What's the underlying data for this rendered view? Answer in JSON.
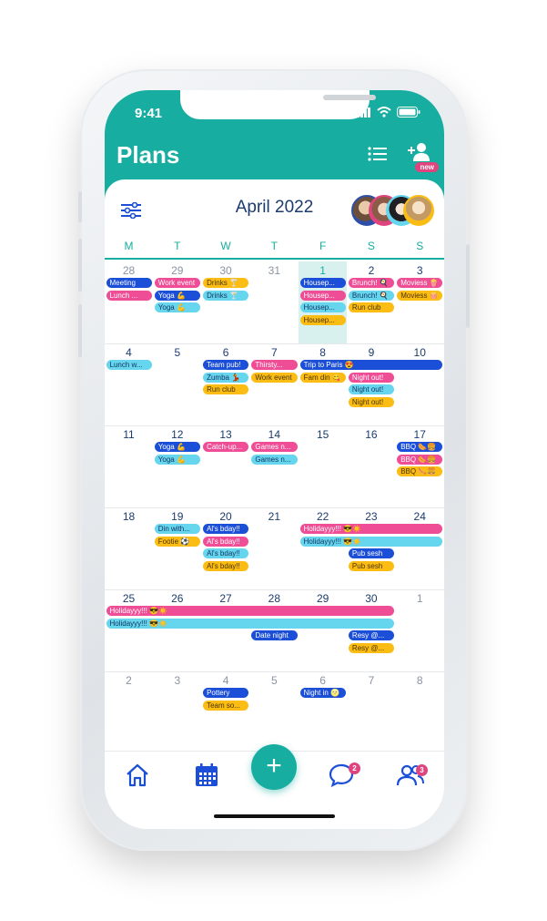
{
  "status_bar": {
    "time": "9:41"
  },
  "header": {
    "title": "Plans",
    "new_badge": "new",
    "list_icon": "list-icon",
    "add_person_icon": "add-person-icon"
  },
  "calendar": {
    "month": "April 2022",
    "weekdays": [
      "M",
      "T",
      "W",
      "T",
      "F",
      "S",
      "S"
    ],
    "weeks": [
      [
        {
          "day": "28",
          "muted": true,
          "events": [
            {
              "text": "Meeting",
              "color": "blue"
            },
            {
              "text": "Lunch ...",
              "color": "pink"
            }
          ]
        },
        {
          "day": "29",
          "muted": true,
          "events": [
            {
              "text": "Work event",
              "color": "pink"
            },
            {
              "text": "Yoga 💪",
              "color": "blue"
            },
            {
              "text": "Yoga 💪",
              "color": "cyan"
            }
          ]
        },
        {
          "day": "30",
          "muted": true,
          "events": [
            {
              "text": "Drinks 🍸",
              "color": "yellow"
            },
            {
              "text": "Drinks 🍸",
              "color": "cyan"
            }
          ]
        },
        {
          "day": "31",
          "muted": true,
          "events": []
        },
        {
          "day": "1",
          "today": true,
          "events": [
            {
              "text": "Housep...",
              "color": "blue"
            },
            {
              "text": "Housep...",
              "color": "pink"
            },
            {
              "text": "Housep...",
              "color": "cyan"
            },
            {
              "text": "Housep...",
              "color": "yellow"
            }
          ]
        },
        {
          "day": "2",
          "events": [
            {
              "text": "Brunch! 🍳",
              "color": "pink"
            },
            {
              "text": "Brunch! 🍳",
              "color": "cyan"
            },
            {
              "text": "Run club",
              "color": "yellow"
            }
          ]
        },
        {
          "day": "3",
          "events": [
            {
              "text": "Moviess 🍿",
              "color": "pink"
            },
            {
              "text": "Moviess 🍿",
              "color": "yellow"
            }
          ]
        }
      ],
      [
        {
          "day": "4",
          "events": [
            {
              "text": "Lunch w...",
              "color": "cyan"
            }
          ]
        },
        {
          "day": "5",
          "events": []
        },
        {
          "day": "6",
          "events": [
            {
              "text": "Team pub!",
              "color": "blue"
            },
            {
              "text": "Zumba 💃",
              "color": "cyan"
            },
            {
              "text": "Run club",
              "color": "yellow"
            }
          ]
        },
        {
          "day": "7",
          "events": [
            {
              "text": "Thirsty...",
              "color": "pink"
            },
            {
              "text": "Work event",
              "color": "yellow"
            }
          ]
        },
        {
          "day": "8",
          "events": [
            {
              "text": "Fam din 😋",
              "color": "yellow"
            }
          ]
        },
        {
          "day": "9",
          "events": [
            {
              "text": "Night out!",
              "color": "pink"
            },
            {
              "text": "Night out!",
              "color": "cyan"
            },
            {
              "text": "Night out!",
              "color": "yellow"
            }
          ]
        },
        {
          "day": "10",
          "events": []
        }
      ],
      [
        {
          "day": "11",
          "events": []
        },
        {
          "day": "12",
          "events": [
            {
              "text": "Yoga 💪",
              "color": "blue"
            },
            {
              "text": "Yoga 💪",
              "color": "cyan"
            }
          ]
        },
        {
          "day": "13",
          "events": [
            {
              "text": "Catch-up...",
              "color": "pink"
            }
          ]
        },
        {
          "day": "14",
          "events": [
            {
              "text": "Games n...",
              "color": "pink"
            },
            {
              "text": "Games n...",
              "color": "cyan"
            }
          ]
        },
        {
          "day": "15",
          "events": []
        },
        {
          "day": "16",
          "events": []
        },
        {
          "day": "17",
          "events": [
            {
              "text": "BBQ 🌭🍔",
              "color": "blue"
            },
            {
              "text": "BBQ 🌭🍔",
              "color": "pink"
            },
            {
              "text": "BBQ 🌭🍔",
              "color": "yellow"
            }
          ]
        }
      ],
      [
        {
          "day": "18",
          "events": []
        },
        {
          "day": "19",
          "events": [
            {
              "text": "Din with...",
              "color": "cyan"
            },
            {
              "text": "Footie ⚽",
              "color": "yellow"
            }
          ]
        },
        {
          "day": "20",
          "events": [
            {
              "text": "Al's bday!!",
              "color": "blue"
            },
            {
              "text": "Al's bday!!",
              "color": "pink"
            },
            {
              "text": "Al's bday!!",
              "color": "cyan"
            },
            {
              "text": "Al's bday!!",
              "color": "yellow"
            }
          ]
        },
        {
          "day": "21",
          "events": []
        },
        {
          "day": "22",
          "events": []
        },
        {
          "day": "23",
          "events": [
            {
              "text": "Pub sesh",
              "color": "blue"
            },
            {
              "text": "Pub sesh",
              "color": "yellow"
            }
          ]
        },
        {
          "day": "24",
          "events": []
        }
      ],
      [
        {
          "day": "25",
          "events": []
        },
        {
          "day": "26",
          "events": []
        },
        {
          "day": "27",
          "events": []
        },
        {
          "day": "28",
          "events": [
            {
              "text": "Date night",
              "color": "blue"
            }
          ]
        },
        {
          "day": "29",
          "events": []
        },
        {
          "day": "30",
          "events": [
            {
              "text": "Resy @...",
              "color": "blue"
            },
            {
              "text": "Resy @...",
              "color": "yellow"
            }
          ]
        },
        {
          "day": "1",
          "muted": true,
          "events": []
        }
      ],
      [
        {
          "day": "2",
          "muted": true,
          "events": []
        },
        {
          "day": "3",
          "muted": true,
          "events": []
        },
        {
          "day": "4",
          "muted": true,
          "events": [
            {
              "text": "Pottery",
              "color": "blue"
            },
            {
              "text": "Team so...",
              "color": "yellow"
            }
          ]
        },
        {
          "day": "5",
          "muted": true,
          "events": []
        },
        {
          "day": "6",
          "muted": true,
          "events": [
            {
              "text": "Night in 🌝",
              "color": "blue"
            }
          ]
        },
        {
          "day": "7",
          "muted": true,
          "events": []
        },
        {
          "day": "8",
          "muted": true,
          "events": []
        }
      ]
    ],
    "span_events": [
      {
        "text": "Trip to Paris 😍",
        "color": "blue",
        "week": 1,
        "start": 4,
        "end": 6,
        "slot": 0
      },
      {
        "text": "Holidayyy!!! 😎☀️",
        "color": "pink",
        "week": 3,
        "start": 4,
        "end": 6,
        "slot": 0
      },
      {
        "text": "Holidayyy!!! 😎☀️",
        "color": "cyan",
        "week": 3,
        "start": 4,
        "end": 6,
        "slot": 1
      },
      {
        "text": "Holidayyy!!! 😎☀️",
        "color": "pink",
        "week": 4,
        "start": 0,
        "end": 5,
        "slot": 0
      },
      {
        "text": "Holidayyy!!! 😎☀️",
        "color": "cyan",
        "week": 4,
        "start": 0,
        "end": 5,
        "slot": 1
      }
    ]
  },
  "nav": {
    "home_icon": "home-icon",
    "calendar_icon": "calendar-icon",
    "add_label": "+",
    "chat_badge": "2",
    "friends_badge": "3"
  },
  "colors": {
    "teal": "#17ada0",
    "navy": "#1b3b6f",
    "blue": "#1b4fd8",
    "pink": "#ef4d95",
    "cyan": "#66d6ee",
    "yellow": "#fbbd14"
  }
}
